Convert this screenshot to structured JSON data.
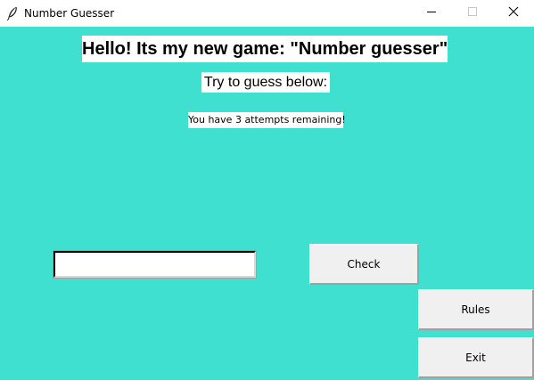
{
  "window": {
    "title": "Number Guesser",
    "controls": {
      "minimize": "minimize-icon",
      "maximize": "maximize-icon",
      "close": "close-icon"
    },
    "app_icon": "feather-icon"
  },
  "colors": {
    "background": "#40e0d0",
    "button_face": "#f0f0f0",
    "label_background": "#ffffff"
  },
  "main": {
    "heading": "Hello! Its my new game: \"Number guesser\"",
    "subheading": "Try to guess below:",
    "attempts_text": "You have 3 attempts remaining!",
    "guess_input": {
      "value": "",
      "placeholder": ""
    },
    "check_label": "Check",
    "rules_label": "Rules",
    "exit_label": "Exit"
  }
}
